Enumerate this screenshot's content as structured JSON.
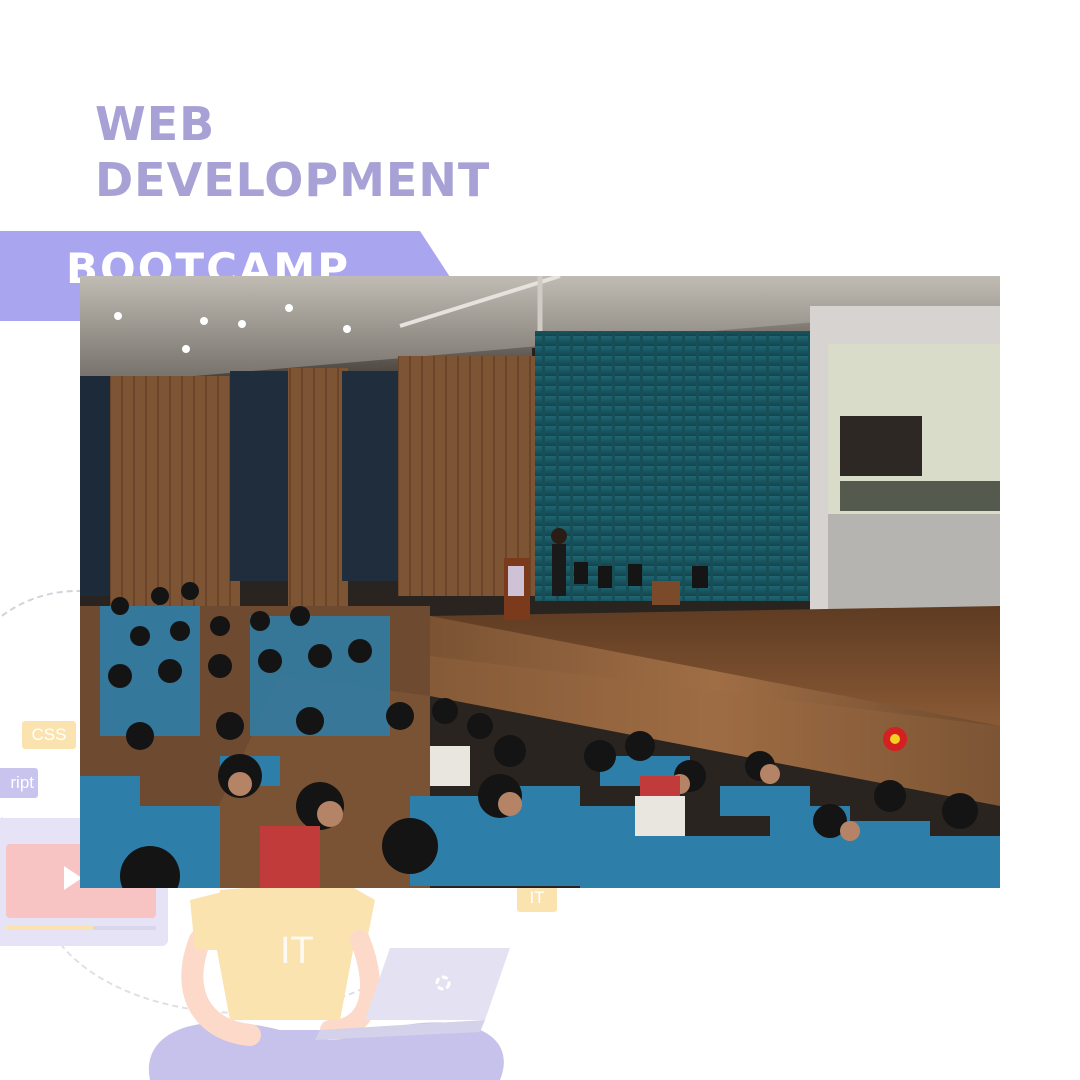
{
  "title": {
    "line1": "WEB",
    "line2": "DEVELOPMENT"
  },
  "banner": {
    "label": "BOOTCAMP"
  },
  "decor": {
    "css_tag": "CSS",
    "script_tag": "ript",
    "it_tag": "IT",
    "shirt_text": "IT",
    "video_progress": 0.58,
    "icons": [
      "play-icon",
      "laptop-icon"
    ]
  },
  "photo": {
    "subject": "auditorium-event-photo"
  },
  "colors": {
    "title": "#a7a1d6",
    "banner": "#a9a6ef",
    "tag_yellow": "#fbe3b0",
    "tag_purple": "#c8c4ee",
    "seat": "#2d7ea8"
  }
}
